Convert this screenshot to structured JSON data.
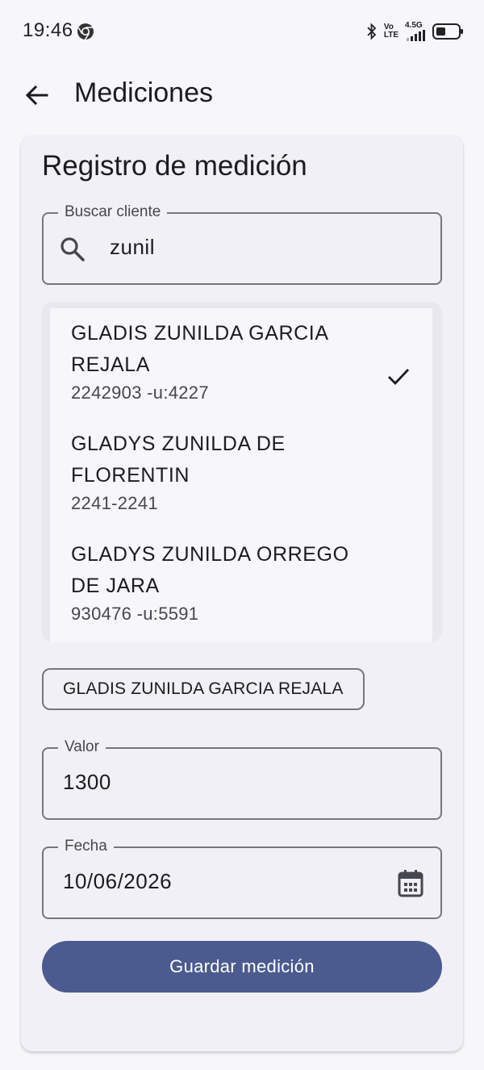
{
  "status_bar": {
    "time": "19:46",
    "net_top": "Vo",
    "net_bottom": "LTE",
    "net_gen": "4.5G"
  },
  "app_bar": {
    "title": "Mediciones"
  },
  "card": {
    "title": "Registro de medición",
    "search": {
      "label": "Buscar cliente",
      "value": "zunil"
    },
    "results": [
      {
        "name": "GLADIS ZUNILDA GARCIA REJALA",
        "sub": "2242903 -u:4227",
        "selected": true
      },
      {
        "name": "GLADYS ZUNILDA DE FLORENTIN",
        "sub": "2241-2241",
        "selected": false
      },
      {
        "name": "GLADYS ZUNILDA ORREGO DE JARA",
        "sub": "930476 -u:5591",
        "selected": false
      }
    ],
    "selected_chip": "GLADIS ZUNILDA GARCIA REJALA",
    "valor": {
      "label": "Valor",
      "value": "1300"
    },
    "fecha": {
      "label": "Fecha",
      "value": "10/06/2026"
    },
    "save_label": "Guardar medición"
  },
  "colors": {
    "primary": "#4b5b8f",
    "background": "#f7f6fb",
    "card": "#f1f0f7"
  }
}
